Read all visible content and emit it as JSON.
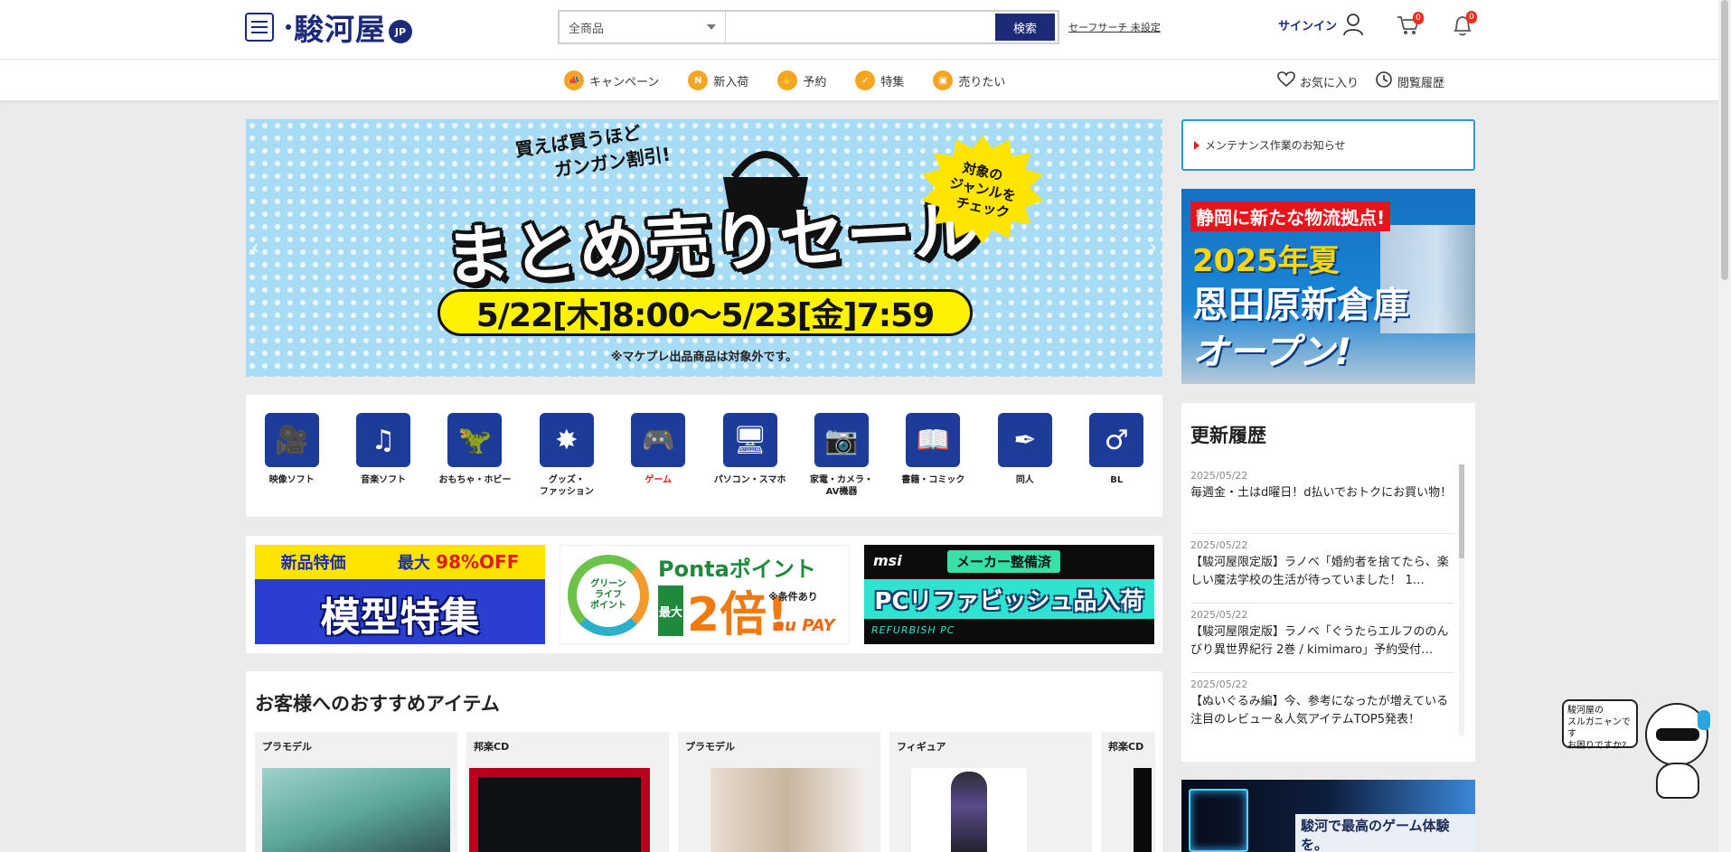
{
  "header": {
    "logo_text": "駿河屋",
    "logo_suffix": "JP",
    "search": {
      "category": "全商品",
      "placeholder": "",
      "button_label": "検索"
    },
    "safe_search_label": "セーフサーチ 未設定",
    "signin_label": "サインイン",
    "cart_count": "0",
    "notification_count": "0"
  },
  "nav": {
    "items": [
      {
        "label": "キャンペーン",
        "icon": "megaphone-icon"
      },
      {
        "label": "新入荷",
        "icon": "new-icon"
      },
      {
        "label": "予約",
        "icon": "hand-icon"
      },
      {
        "label": "特集",
        "icon": "shield-icon"
      },
      {
        "label": "売りたい",
        "icon": "box-icon"
      }
    ],
    "favorites_label": "お気に入り",
    "history_label": "閲覧履歴"
  },
  "hero": {
    "sub_line1": "買えば買うほど",
    "sub_line2": "ガンガン割引!",
    "title": "まとめ売りセール",
    "burst_line1": "対象の",
    "burst_line2": "ジャンルを",
    "burst_line3": "チェック",
    "date": "5/22[木]8:00～5/23[金]7:59",
    "note": "※マケプレ出品商品は対象外です。",
    "prev_arrow": "‹",
    "next_arrow": "›"
  },
  "categories": [
    {
      "label": "映像ソフト",
      "icon": "video-camera-icon",
      "glyph": "🎥",
      "highlight": false
    },
    {
      "label": "音楽ソフト",
      "icon": "music-note-icon",
      "glyph": "♫",
      "highlight": false
    },
    {
      "label": "おもちゃ・ホビー",
      "icon": "dinosaur-icon",
      "glyph": "🦖",
      "highlight": false
    },
    {
      "label": "グッズ・\nファッション",
      "icon": "star-badge-icon",
      "glyph": "✸",
      "highlight": false
    },
    {
      "label": "ゲーム",
      "icon": "gamepad-icon",
      "glyph": "🎮",
      "highlight": true
    },
    {
      "label": "パソコン・スマホ",
      "icon": "devices-icon",
      "glyph": "🖥",
      "highlight": false
    },
    {
      "label": "家電・カメラ・\nAV機器",
      "icon": "camera-headphones-icon",
      "glyph": "📷",
      "highlight": false
    },
    {
      "label": "書籍・コミック",
      "icon": "book-icon",
      "glyph": "📖",
      "highlight": false
    },
    {
      "label": "同人",
      "icon": "quill-icon",
      "glyph": "✒",
      "highlight": false
    },
    {
      "label": "BL",
      "icon": "male-symbol-icon",
      "glyph": "♂",
      "highlight": false
    }
  ],
  "banners": {
    "model": {
      "tag1": "新品特価",
      "tag2_prefix": "最大",
      "tag2_value": "98%OFF",
      "title": "模型特集"
    },
    "ponta": {
      "ring": "グリーン\nライフ\nポイント",
      "title": "Pontaポイント",
      "max": "最大",
      "double": "2倍!",
      "cond": "※条件あり",
      "au": "au PAY"
    },
    "pc": {
      "brand": "msi",
      "tag": "メーカー整備済",
      "title": "PCリファビッシュ品入荷",
      "sub": "REFURBISH PC"
    }
  },
  "recommend": {
    "title": "お客様へのおすすめアイテム",
    "items": [
      {
        "category": "プラモデル"
      },
      {
        "category": "邦楽CD"
      },
      {
        "category": "プラモデル"
      },
      {
        "category": "フィギュア"
      },
      {
        "category": "邦楽CD"
      }
    ]
  },
  "sidebar": {
    "notice": "メンテナンス作業のお知らせ",
    "promo": {
      "line1": "静岡に新たな物流拠点!",
      "line2": "2025年夏",
      "line3": "恩田原新倉庫",
      "line4": "オープン!"
    },
    "updates_title": "更新履歴",
    "updates": [
      {
        "date": "2025/05/22",
        "text": "毎週金・土はd曜日！d払いでおトクにお買い物！"
      },
      {
        "date": "2025/05/22",
        "text": "【駿河屋限定版】ラノベ「婚約者を捨てたら、楽しい魔法学校の生活が待っていました！ 1…"
      },
      {
        "date": "2025/05/22",
        "text": "【駿河屋限定版】ラノベ「ぐうたらエルフののんびり異世界紀行 2巻 / kimimaro」予約受付…"
      },
      {
        "date": "2025/05/22",
        "text": "【ぬいぐるみ編】今、参考になったが増えている注目のレビュー＆人気アイテムTOP5発表！"
      }
    ],
    "game_banner": "駿河で最高のゲーム体験を。"
  },
  "mascot": {
    "bubble": "駿河屋の\nスルガニャンです\nお困りですか?"
  },
  "colors": {
    "brand": "#1d2a78",
    "category_blue": "#1d3c9a",
    "accent_red": "#e0201b",
    "notice_border": "#2a9bd6",
    "nav_icon": "#f4a623"
  }
}
